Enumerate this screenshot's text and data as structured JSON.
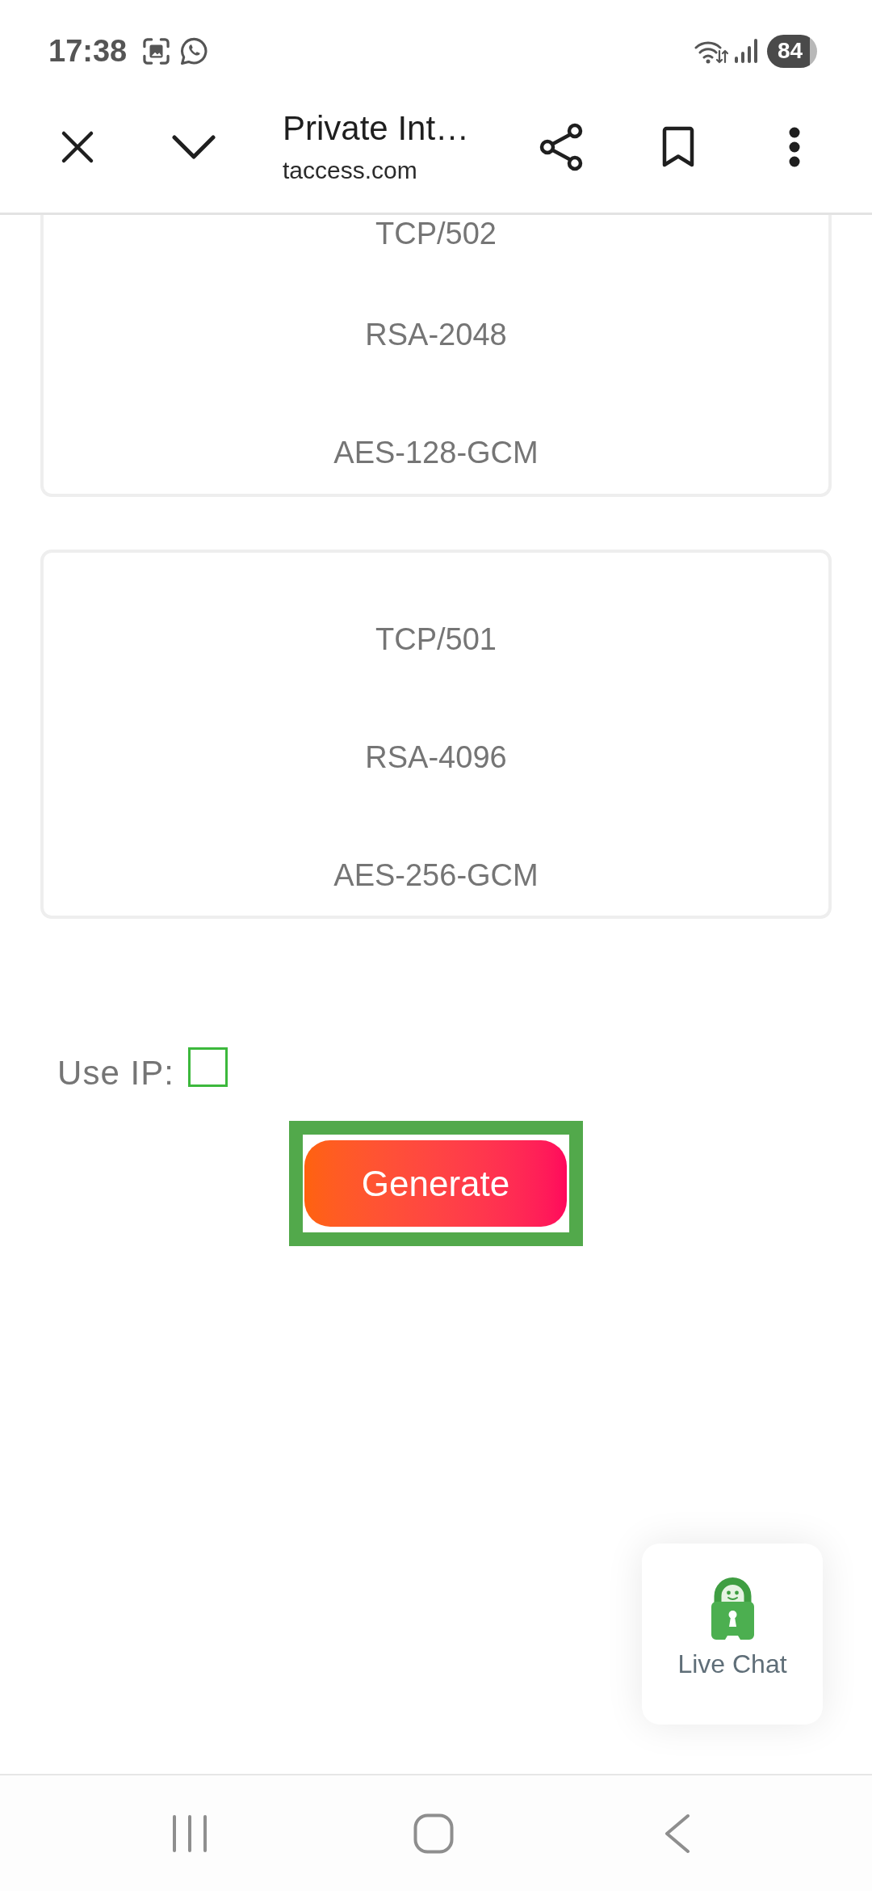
{
  "status_bar": {
    "time": "17:38",
    "battery": "84"
  },
  "toolbar": {
    "title": "Private Int…",
    "url": "taccess.com"
  },
  "cards": [
    {
      "rows": [
        "TCP/502",
        "RSA-2048",
        "AES-128-GCM"
      ]
    },
    {
      "rows": [
        "TCP/501",
        "RSA-4096",
        "AES-256-GCM"
      ]
    }
  ],
  "use_ip": {
    "label": "Use IP:",
    "checked": false
  },
  "generate_button": {
    "label": "Generate",
    "highlighted": true
  },
  "live_chat": {
    "label": "Live Chat"
  }
}
